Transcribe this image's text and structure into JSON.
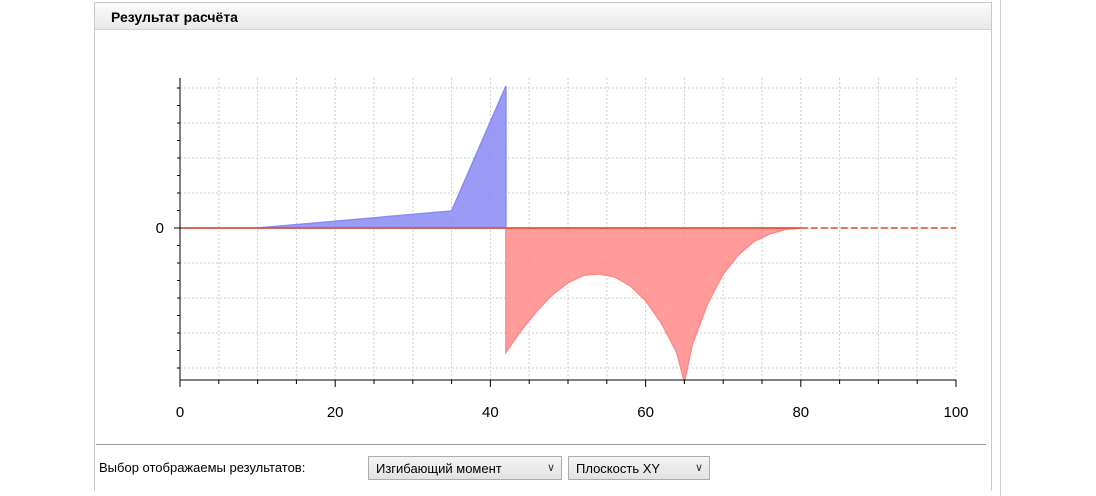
{
  "panel": {
    "title": "Результат расчёта"
  },
  "footer": {
    "label": "Выбор отображаемы результатов:",
    "result_select": {
      "value": "Изгибающий момент"
    },
    "plane_select": {
      "value": "Плоскость XY"
    }
  },
  "icons": {
    "dropdown": "chevron-down-icon"
  },
  "chart_data": {
    "type": "area",
    "xlim": [
      0,
      100
    ],
    "ylim": [
      -1.0,
      1.0
    ],
    "x_ticks": [
      "0",
      "20",
      "40",
      "60",
      "80",
      "100"
    ],
    "y_tick_labels": [
      "0"
    ],
    "grid": true,
    "series": [
      {
        "color": "#8a8af5",
        "x": [
          0,
          10,
          35,
          42,
          42
        ],
        "y": [
          0,
          0,
          0.12,
          1.0,
          0
        ]
      },
      {
        "color": "#ff8a8a",
        "x": [
          42,
          42,
          44,
          46,
          48,
          50,
          52,
          54,
          56,
          58,
          60,
          62,
          64,
          65,
          66,
          68,
          70,
          72,
          74,
          76,
          78,
          80
        ],
        "y": [
          0,
          -0.84,
          -0.69,
          -0.56,
          -0.45,
          -0.37,
          -0.32,
          -0.31,
          -0.33,
          -0.39,
          -0.49,
          -0.64,
          -0.84,
          -1.04,
          -0.79,
          -0.51,
          -0.31,
          -0.18,
          -0.09,
          -0.04,
          -0.01,
          0
        ]
      }
    ],
    "baseline_color": "#e04a2a"
  }
}
